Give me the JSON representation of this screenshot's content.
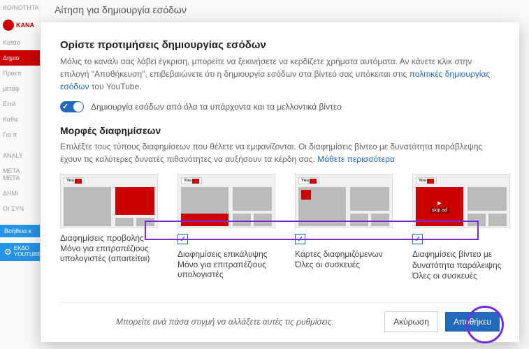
{
  "sidebar": {
    "community": "ΚΟΙΝΟΤΗΤΑ",
    "channel": "ΚΑΝΑ",
    "items": [
      "Κατάσ",
      "Δημιο",
      "Προεπ",
      "μεταφ",
      "Επιλ",
      "Καθιε",
      "Για π"
    ],
    "analytics": "ANALY",
    "meta": "ΜΕΤΑ\nΜΕΤΑ",
    "dim": "ΔΗΜΙ",
    "sync": "ΟΙ ΣΥΝ",
    "help": "Βοήθεια κ",
    "studio_line1": "ΕΚΔΟ",
    "studio_line2": "YOUTUBE STUDIO"
  },
  "page": {
    "title": "Αίτηση για δημιουργία εσόδων"
  },
  "modal": {
    "pref_heading": "Ορίστε προτιμήσεις δημιουργίας εσόδων",
    "pref_desc_pre": "Μόλις το κανάλι σας λάβει έγκριση, μπορείτε να ξεκινήσετε να κερδίζετε χρήματα αυτόματα. Αν κάνετε κλικ στην επιλογή \"Αποθήκευση\", επιβεβαιώνετε ότι η δημιουργία εσόδων στα βίντεό σας υπόκειται στις ",
    "pref_link": "πολιτικές δημιουργίας εσόδων",
    "pref_desc_post": " του YouTube.",
    "toggle_label": "Δημιουργία εσόδων από όλα τα υπάρχοντα και τα μελλοντικά βίντεο",
    "formats_heading": "Μορφές διαφημίσεων",
    "formats_desc": "Επιλέξτε τους τύπους διαφημίσεων που θέλετε να εμφανίζονται. Οι διαφημίσεις βίντεο με δυνατότητα παράβλεψης έχουν τις καλύτερες δυνατές πιθανότητες να αυξήσουν τα κέρδη σας. ",
    "learn_more": "Μάθετε περισσότερα",
    "skip_ad": "skip ad",
    "formats": [
      {
        "title": "Διαφημίσεις προβολής",
        "sub": "Μόνο για επιτραπέζιους υπολογιστές (απαιτείται)",
        "checked": false
      },
      {
        "title": "Διαφημίσεις επικάλυψης",
        "sub": "Μόνο για επιτραπέζιους υπολογιστές",
        "checked": true
      },
      {
        "title": "Κάρτες διαφημιζόμενων",
        "sub": "Όλες οι συσκευές",
        "checked": true
      },
      {
        "title": "Διαφημίσεις βίντεο με δυνατότητα παράλειψης",
        "sub": "Όλες οι συσκευές",
        "checked": true
      }
    ],
    "footer_note": "Μπορείτε ανά πάσα στιγμή να αλλάξετε αυτές τις ρυθμίσεις.",
    "cancel": "Ακύρωση",
    "save": "Αποθήκευ"
  }
}
